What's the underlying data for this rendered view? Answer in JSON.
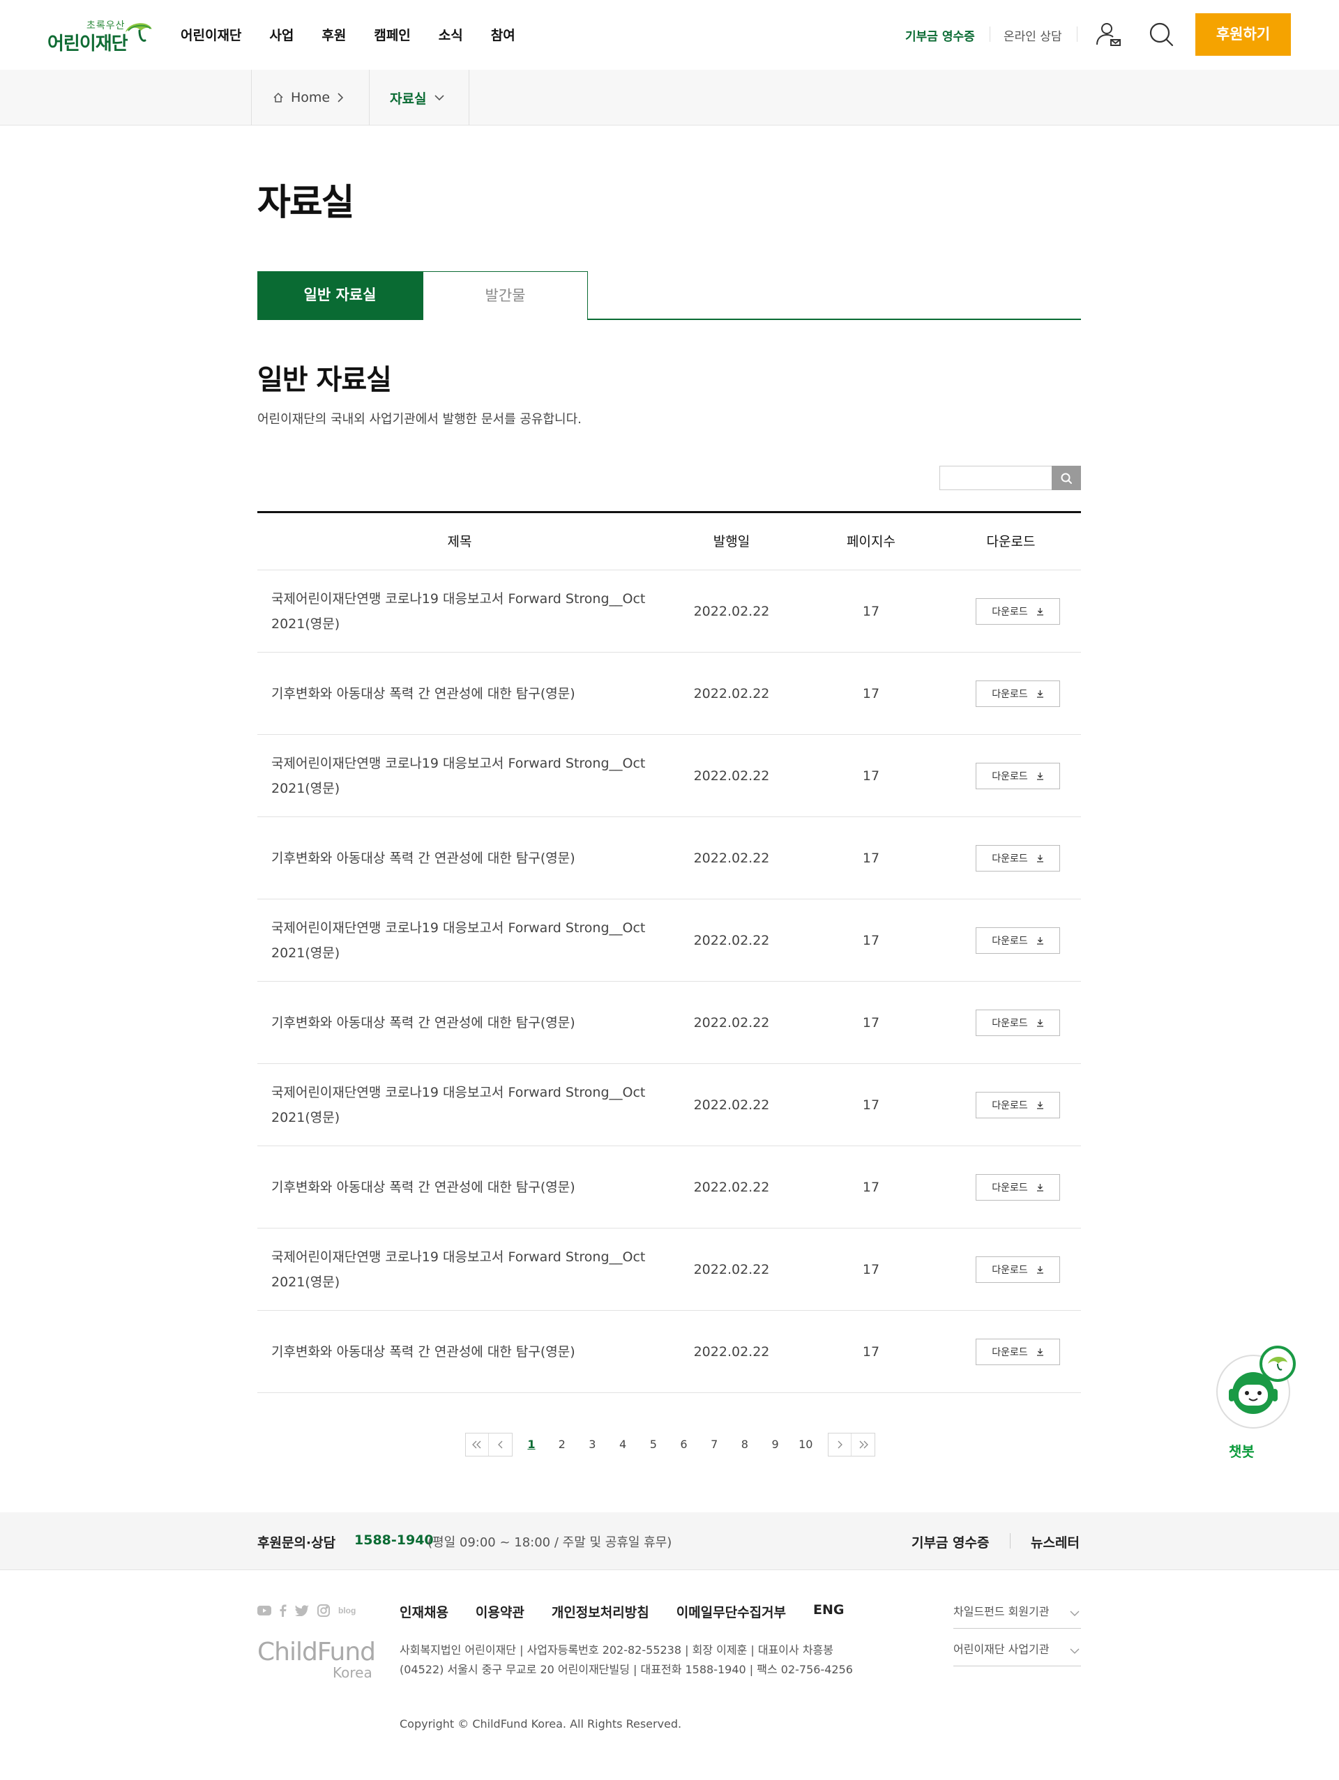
{
  "header": {
    "logo_sub": "초록우산",
    "logo_main": "어린이재단",
    "nav": [
      "어린이재단",
      "사업",
      "후원",
      "캠페인",
      "소식",
      "참여"
    ],
    "util_receipt": "기부금 영수증",
    "util_consult": "온라인 상담",
    "donate_button": "후원하기",
    "colors": {
      "brand_green": "#0a6b33",
      "donate_orange": "#f5a300"
    }
  },
  "breadcrumb": {
    "home": "Home",
    "current": "자료실"
  },
  "page": {
    "title": "자료실"
  },
  "tabs": [
    "일반 자료실",
    "발간물"
  ],
  "section": {
    "title": "일반 자료실",
    "description": "어린이재단의 국내외 사업기관에서 발행한 문서를 공유합니다."
  },
  "search": {
    "value": "",
    "placeholder": ""
  },
  "table": {
    "headers": [
      "제목",
      "발행일",
      "페이지수",
      "다운로드"
    ],
    "download_label": "다운로드",
    "rows": [
      {
        "title": "국제어린이재단연맹 코로나19 대응보고서 Forward Strong__Oct 2021(영문)",
        "date": "2022.02.22",
        "pages": "17"
      },
      {
        "title": "기후변화와 아동대상 폭력 간 연관성에 대한 탐구(영문)",
        "date": "2022.02.22",
        "pages": "17"
      },
      {
        "title": "국제어린이재단연맹 코로나19 대응보고서 Forward Strong__Oct 2021(영문)",
        "date": "2022.02.22",
        "pages": "17"
      },
      {
        "title": "기후변화와 아동대상 폭력 간 연관성에 대한 탐구(영문)",
        "date": "2022.02.22",
        "pages": "17"
      },
      {
        "title": "국제어린이재단연맹 코로나19 대응보고서 Forward Strong__Oct 2021(영문)",
        "date": "2022.02.22",
        "pages": "17"
      },
      {
        "title": "기후변화와 아동대상 폭력 간 연관성에 대한 탐구(영문)",
        "date": "2022.02.22",
        "pages": "17"
      },
      {
        "title": "국제어린이재단연맹 코로나19 대응보고서 Forward Strong__Oct 2021(영문)",
        "date": "2022.02.22",
        "pages": "17"
      },
      {
        "title": "기후변화와 아동대상 폭력 간 연관성에 대한 탐구(영문)",
        "date": "2022.02.22",
        "pages": "17"
      },
      {
        "title": "국제어린이재단연맹 코로나19 대응보고서 Forward Strong__Oct 2021(영문)",
        "date": "2022.02.22",
        "pages": "17"
      },
      {
        "title": "기후변화와 아동대상 폭력 간 연관성에 대한 탐구(영문)",
        "date": "2022.02.22",
        "pages": "17"
      }
    ]
  },
  "pagination": {
    "pages": [
      "1",
      "2",
      "3",
      "4",
      "5",
      "6",
      "7",
      "8",
      "9",
      "10"
    ],
    "current": "1"
  },
  "chatbot": {
    "label": "챗봇"
  },
  "footer": {
    "inquiry_label": "후원문의·상담",
    "phone": "1588-1940",
    "hours": "(평일 09:00 ~ 18:00 / 주말 및 공휴일 휴무)",
    "receipt": "기부금 영수증",
    "newsletter": "뉴스레터",
    "sns": [
      "youtube-icon",
      "facebook-icon",
      "twitter-icon",
      "instagram-icon",
      "blog-icon"
    ],
    "sns_blog_text": "blog",
    "links": [
      "인재채용",
      "이용약관",
      "개인정보처리방침",
      "이메일무단수집거부",
      "ENG"
    ],
    "family_sites": [
      "차일드펀드 회원기관",
      "어린이재단 사업기관"
    ],
    "logo_main": "ChildFund",
    "logo_sub": "Korea",
    "address_line1": "사회복지법인 어린이재단 | 사업자등록번호 202-82-55238 | 회장 이제훈 | 대표이사 차흥봉",
    "address_line2": "(04522) 서울시 중구 무교로 20 어린이재단빌딩 | 대표전화 1588-1940 | 팩스 02-756-4256",
    "copyright": "Copyright © ChildFund Korea. All Rights Reserved."
  }
}
